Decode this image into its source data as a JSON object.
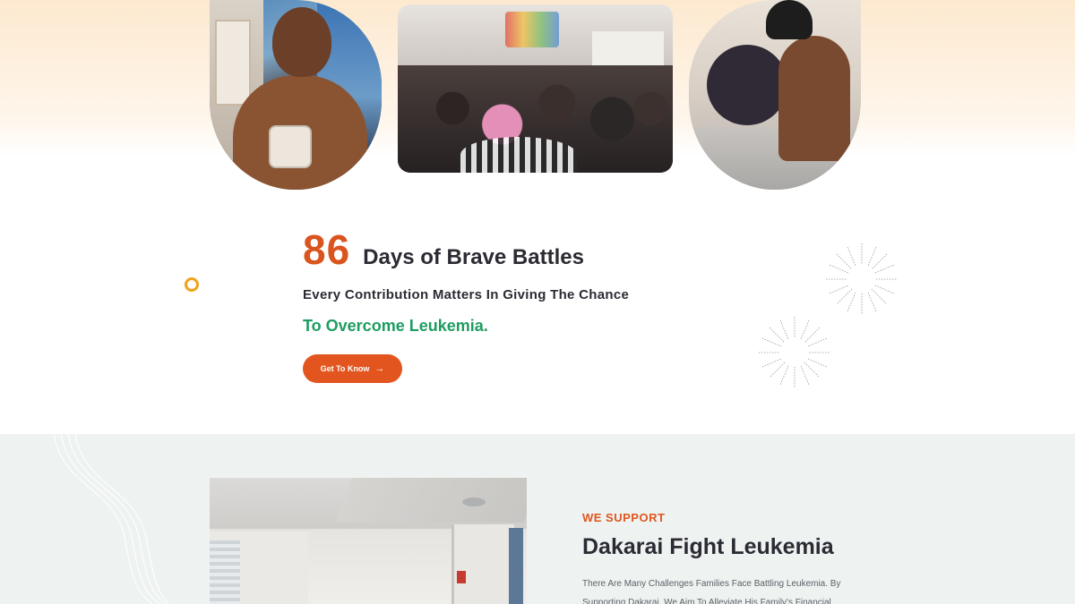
{
  "hero": {
    "photos": [
      {
        "alt": "photo-left"
      },
      {
        "alt": "photo-middle"
      },
      {
        "alt": "photo-right"
      }
    ],
    "stat_number": "86",
    "stat_label": "Days of Brave Battles",
    "subline": "Every Contribution Matters In Giving The Chance",
    "highlight": "To Overcome Leukemia.",
    "cta_label": "Get To Know",
    "colors": {
      "accent": "#e2551f",
      "highlight": "#1d9d60",
      "ring": "#f0a21a"
    }
  },
  "support": {
    "eyebrow": "WE SUPPORT",
    "title": "Dakarai Fight Leukemia",
    "body": "There Are Many Challenges Families Face Battling Leukemia. By Supporting Dakarai, We Aim To Alleviate His Family's Financial"
  },
  "icons": {
    "cta_arrow": "arrow-right-icon"
  }
}
